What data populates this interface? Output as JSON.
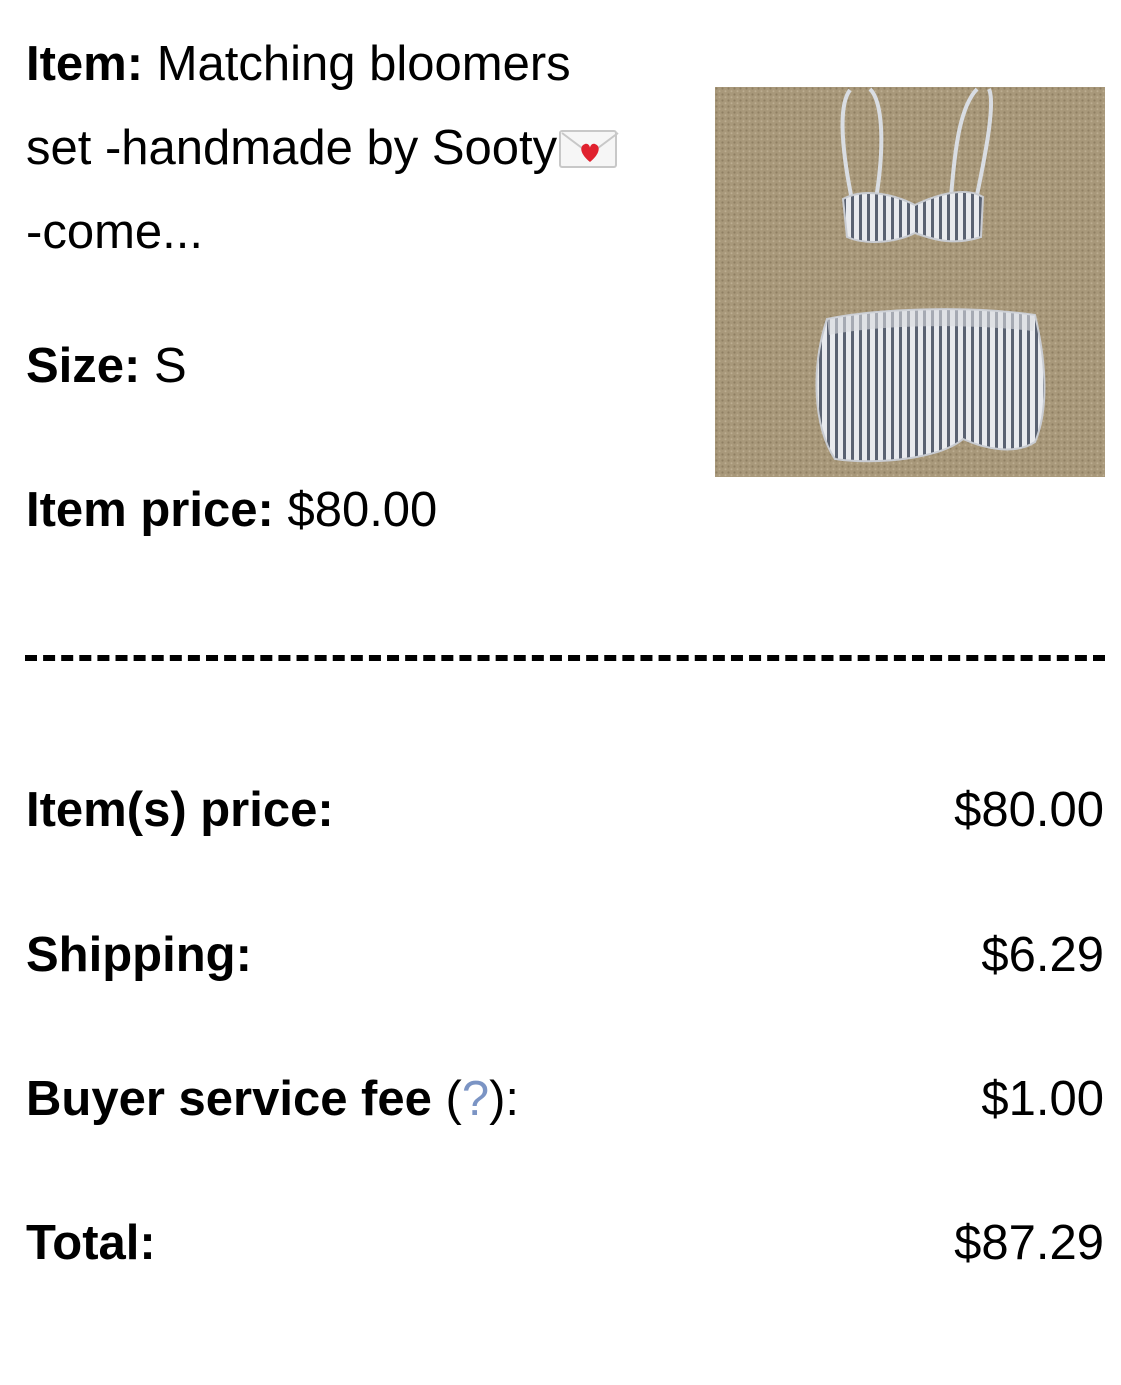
{
  "item": {
    "label": "Item:",
    "title_line1": "Matching bloomers",
    "title_line2": "set -handmade by Sooty",
    "title_line3": "-come...",
    "emoji_icon": "love-letter-icon"
  },
  "size": {
    "label": "Size:",
    "value": "S"
  },
  "item_price": {
    "label": "Item price:",
    "value": "$80.00"
  },
  "summary": {
    "items_price": {
      "label": "Item(s) price:",
      "value": "$80.00"
    },
    "shipping": {
      "label": "Shipping:",
      "value": "$6.29"
    },
    "fee": {
      "label": "Buyer service fee",
      "open": " (",
      "help": "?",
      "close": "):",
      "value": "$1.00"
    },
    "total": {
      "label": "Total:",
      "value": "$87.29"
    }
  },
  "colors": {
    "help_link": "#7b94c4",
    "carpet": "#a8987a"
  }
}
